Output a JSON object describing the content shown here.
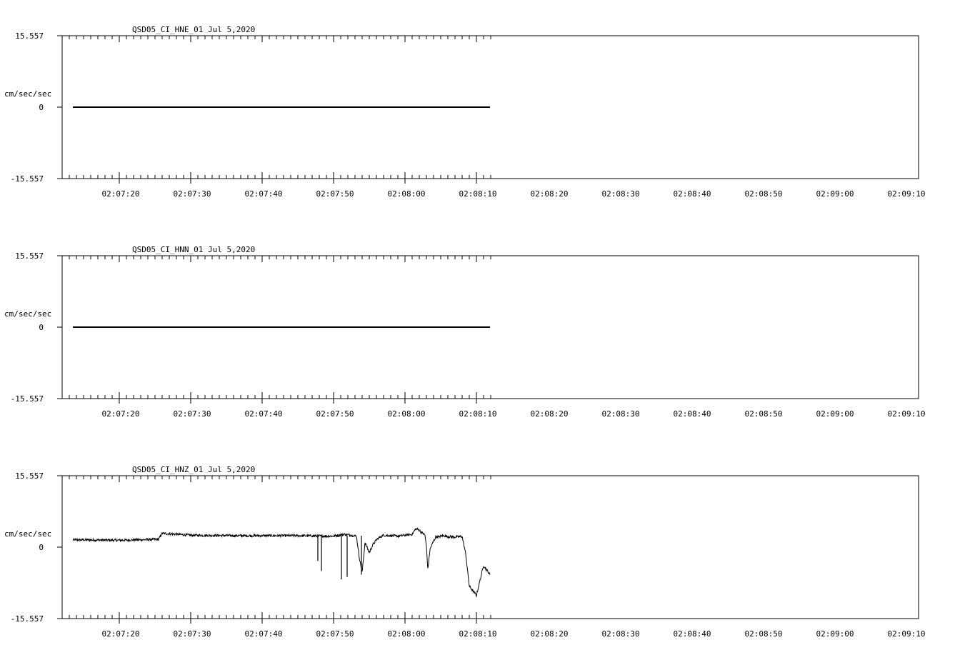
{
  "chart_data": [
    {
      "type": "line",
      "title": "QSD05_CI_HNE_01  Jul 5,2020",
      "ylabel": "cm/sec/sec",
      "ylim": [
        -15.557,
        15.557
      ],
      "y_ticks": [
        "15.557",
        "0",
        "-15.557"
      ],
      "x_ticks": [
        "02:07:20",
        "02:07:30",
        "02:07:40",
        "02:07:50",
        "02:08:00",
        "02:08:10",
        "02:08:20",
        "02:08:30",
        "02:08:40",
        "02:08:50",
        "02:09:00",
        "02:09:10"
      ],
      "x_start_s": 13.5,
      "x_end_s": 71.9,
      "series": [
        {
          "x": [
            13.5,
            71.9
          ],
          "y": [
            0,
            0
          ]
        }
      ]
    },
    {
      "type": "line",
      "title": "QSD05_CI_HNN_01  Jul 5,2020",
      "ylabel": "cm/sec/sec",
      "ylim": [
        -15.557,
        15.557
      ],
      "y_ticks": [
        "15.557",
        "0",
        "-15.557"
      ],
      "x_ticks": [
        "02:07:20",
        "02:07:30",
        "02:07:40",
        "02:07:50",
        "02:08:00",
        "02:08:10",
        "02:08:20",
        "02:08:30",
        "02:08:40",
        "02:08:50",
        "02:09:00",
        "02:09:10"
      ],
      "x_start_s": 13.5,
      "x_end_s": 71.9,
      "series": [
        {
          "x": [
            13.5,
            71.9
          ],
          "y": [
            0,
            0
          ]
        }
      ]
    },
    {
      "type": "line",
      "title": "QSD05_CI_HNZ_01  Jul 5,2020",
      "ylabel": "cm/sec/sec",
      "ylim": [
        -15.557,
        15.557
      ],
      "y_ticks": [
        "15.557",
        "0",
        "-15.557"
      ],
      "x_ticks": [
        "02:07:20",
        "02:07:30",
        "02:07:40",
        "02:07:50",
        "02:08:00",
        "02:08:10",
        "02:08:20",
        "02:08:30",
        "02:08:40",
        "02:08:50",
        "02:09:00",
        "02:09:10"
      ],
      "x_start_s": 13.5,
      "x_end_s": 71.9,
      "series": [
        {
          "x": [
            13.5,
            20,
            25.5,
            26,
            30,
            37,
            45,
            50,
            51.5,
            52.5,
            53.2,
            53.6,
            54.0,
            54.4,
            55.0,
            55.5,
            56.0,
            56.5,
            57.0,
            59.0,
            61.0,
            61.5,
            61.9,
            62.8,
            63.0,
            63.2,
            63.5,
            63.9,
            64.3,
            64.5,
            64.8,
            65.0,
            65.4,
            66.0,
            67.0,
            68.0,
            68.5,
            69.0,
            70.0,
            71.0,
            71.9
          ],
          "y": [
            1.6,
            1.5,
            1.7,
            3.0,
            2.6,
            2.5,
            2.5,
            2.4,
            2.8,
            2.6,
            2.4,
            -2.2,
            -5.5,
            1.0,
            -1.2,
            0.5,
            1.6,
            2.2,
            2.6,
            2.4,
            2.8,
            4.0,
            3.8,
            2.6,
            0.0,
            -4.8,
            -0.5,
            1.0,
            2.2,
            2.3,
            2.2,
            2.4,
            2.5,
            2.3,
            2.2,
            2.3,
            -1.5,
            -8.5,
            -10.5,
            -4.0,
            -6.0
          ]
        }
      ]
    }
  ]
}
